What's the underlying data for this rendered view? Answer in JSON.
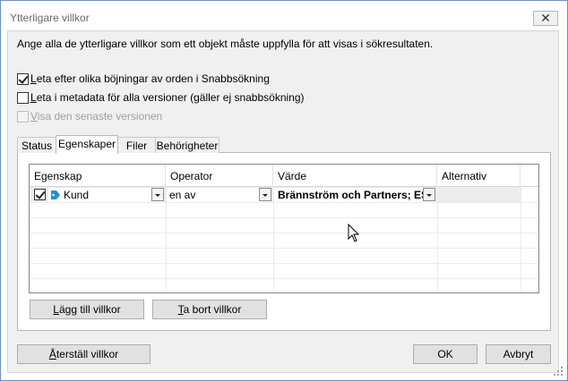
{
  "window": {
    "title": "Ytterligare villkor",
    "close_glyph": "✕"
  },
  "intro_text": "Ange alla de ytterligare villkor som ett objekt måste uppfylla för att visas i sökresultaten.",
  "options": [
    {
      "label_underlined": "L",
      "label_rest": "eta efter olika böjningar av orden i Snabbsökning",
      "checked": true,
      "enabled": true
    },
    {
      "label_underlined": "L",
      "label_rest": "eta i metadata för alla versioner (gäller ej snabbsökning)",
      "checked": false,
      "enabled": true
    },
    {
      "label_underlined": "V",
      "label_rest": "isa den senaste versionen",
      "checked": false,
      "enabled": false
    }
  ],
  "tabs": [
    {
      "label": "Status",
      "active": false
    },
    {
      "label": "Egenskaper",
      "active": true
    },
    {
      "label": "Filer",
      "active": false
    },
    {
      "label": "Behörigheter",
      "active": false
    }
  ],
  "grid": {
    "columns": [
      "Egenskap",
      "Operator",
      "Värde",
      "Alternativ"
    ],
    "rows": [
      {
        "checked": true,
        "icon": "tag-icon",
        "property": "Kund",
        "operator": "en av",
        "value": "Brännström och Partners; ES",
        "alternative": ""
      }
    ]
  },
  "buttons": {
    "add_condition": {
      "underlined": "L",
      "rest": "ägg till villkor"
    },
    "remove_condition": {
      "underlined": "T",
      "rest": "a bort villkor"
    },
    "reset": {
      "underlined": "Å",
      "rest": "terställ villkor"
    },
    "ok": "OK",
    "cancel": "Avbryt"
  },
  "colors": {
    "dialog_border": "#6b8fb8",
    "client_bg": "#f0f0f0",
    "row_highlight": "#ececec",
    "tag_icon": "#2a8fd0"
  }
}
